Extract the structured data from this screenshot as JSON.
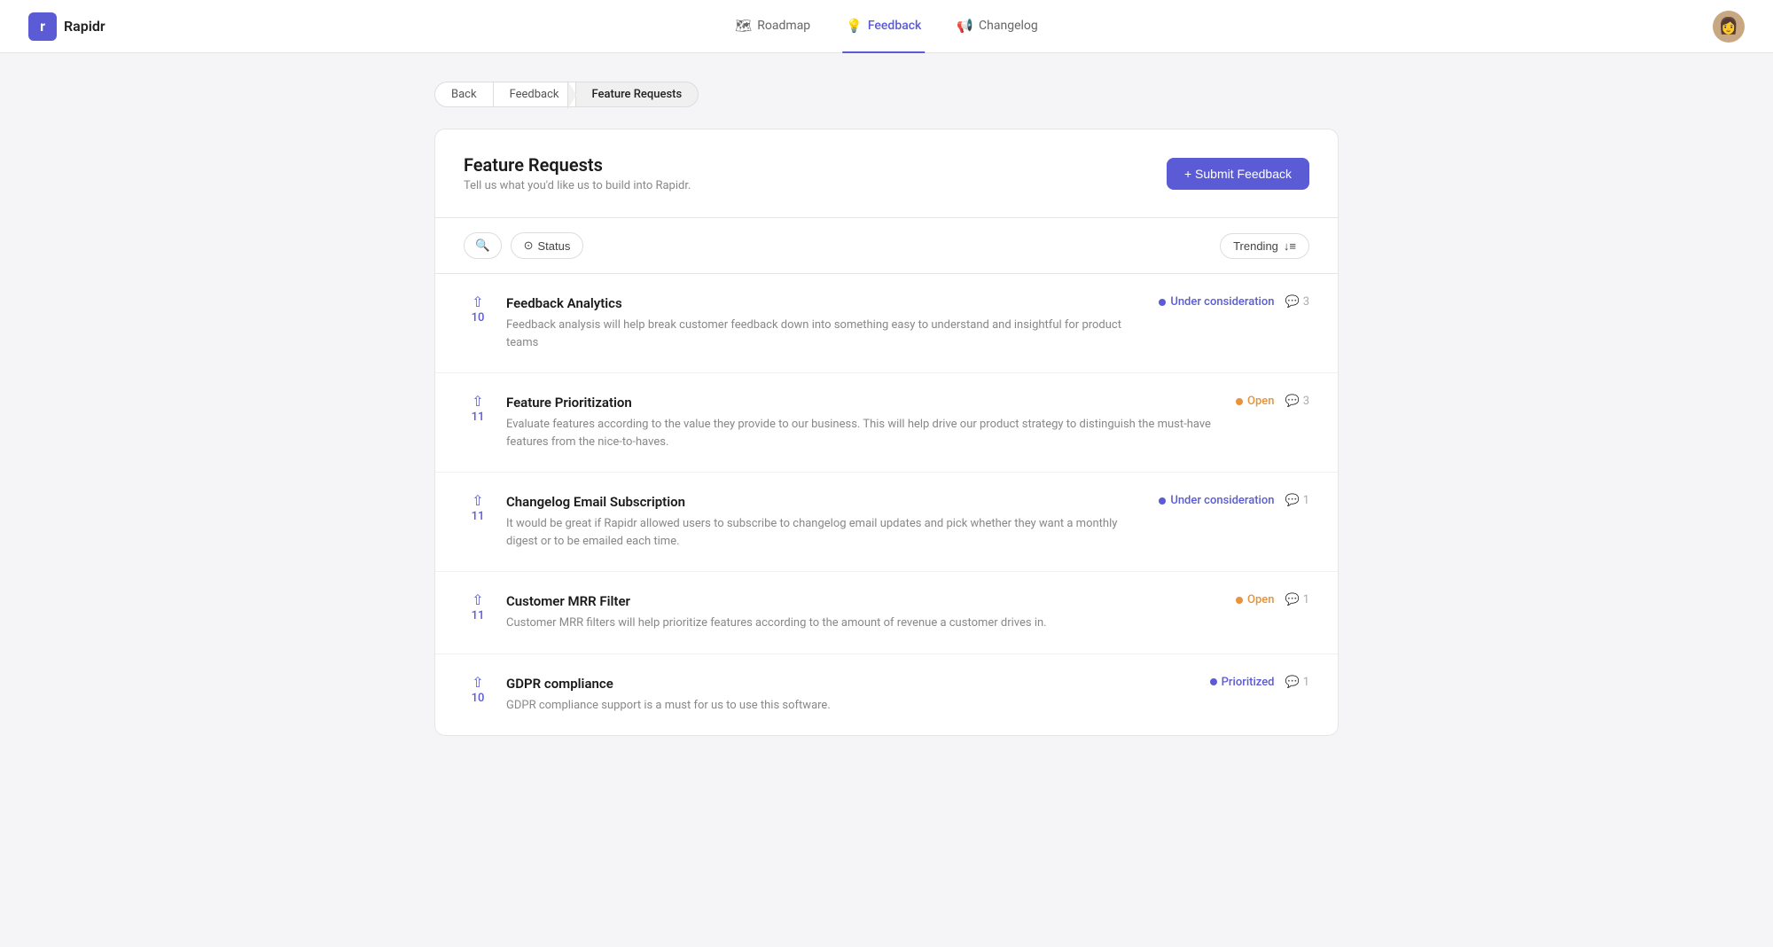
{
  "app": {
    "name": "Rapidr",
    "logo_letter": "r"
  },
  "header": {
    "nav_items": [
      {
        "id": "roadmap",
        "label": "Roadmap",
        "icon": "🗺",
        "active": false
      },
      {
        "id": "feedback",
        "label": "Feedback",
        "icon": "💡",
        "active": true
      },
      {
        "id": "changelog",
        "label": "Changelog",
        "icon": "📢",
        "active": false
      }
    ]
  },
  "breadcrumb": {
    "items": [
      {
        "id": "back",
        "label": "Back",
        "active": false
      },
      {
        "id": "feedback",
        "label": "Feedback",
        "active": false
      },
      {
        "id": "feature-requests",
        "label": "Feature Requests",
        "active": true
      }
    ]
  },
  "page": {
    "title": "Feature Requests",
    "subtitle": "Tell us what you'd like us to build into Rapidr.",
    "submit_btn": "+ Submit Feedback"
  },
  "filters": {
    "search_placeholder": "Search",
    "status_label": "Status",
    "sort_label": "Trending",
    "sort_icon": "↓≡"
  },
  "features": [
    {
      "id": 1,
      "title": "Feedback Analytics",
      "description": "Feedback analysis will help break customer feedback down into something easy to understand and insightful for product teams",
      "votes": 10,
      "status": "Under consideration",
      "status_type": "blue",
      "comments": 3
    },
    {
      "id": 2,
      "title": "Feature Prioritization",
      "description": "Evaluate features according to the value they provide to our business. This will help drive our product strategy to distinguish the must-have features from the nice-to-haves.",
      "votes": 11,
      "status": "Open",
      "status_type": "orange",
      "comments": 3
    },
    {
      "id": 3,
      "title": "Changelog Email Subscription",
      "description": "It would be great if Rapidr allowed users to subscribe to changelog email updates and pick whether they want a monthly digest or to be emailed each time.",
      "votes": 11,
      "status": "Under consideration",
      "status_type": "blue",
      "comments": 1
    },
    {
      "id": 4,
      "title": "Customer MRR Filter",
      "description": "Customer MRR filters will help prioritize features according to the amount of revenue a customer drives in.",
      "votes": 11,
      "status": "Open",
      "status_type": "orange",
      "comments": 1
    },
    {
      "id": 5,
      "title": "GDPR compliance",
      "description": "GDPR compliance support is a must for us to use this software.",
      "votes": 10,
      "status": "Prioritized",
      "status_type": "blue",
      "comments": 1
    }
  ]
}
